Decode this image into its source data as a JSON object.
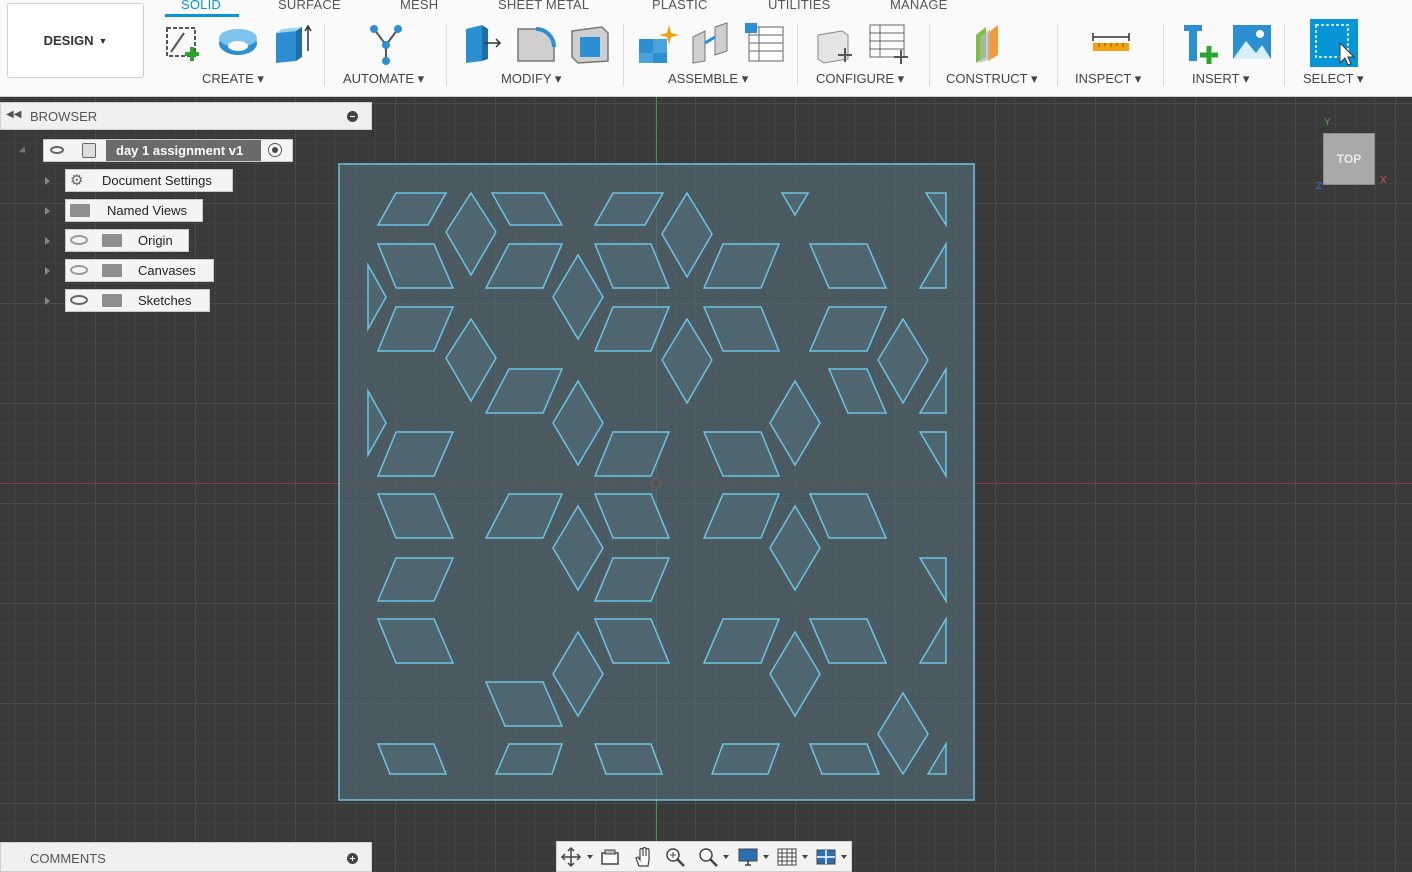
{
  "workspace": {
    "label": "DESIGN"
  },
  "tabs": [
    {
      "label": "SOLID",
      "active": true
    },
    {
      "label": "SURFACE"
    },
    {
      "label": "MESH"
    },
    {
      "label": "SHEET METAL"
    },
    {
      "label": "PLASTIC"
    },
    {
      "label": "UTILITIES"
    },
    {
      "label": "MANAGE"
    }
  ],
  "groups": {
    "create": "CREATE ▾",
    "automate": "AUTOMATE ▾",
    "modify": "MODIFY ▾",
    "assemble": "ASSEMBLE ▾",
    "configure": "CONFIGURE ▾",
    "construct": "CONSTRUCT ▾",
    "inspect": "INSPECT ▾",
    "insert": "INSERT ▾",
    "select": "SELECT ▾"
  },
  "browser": {
    "title": "BROWSER",
    "root": "day 1 assignment v1",
    "items": [
      "Document Settings",
      "Named Views",
      "Origin",
      "Canvases",
      "Sketches"
    ]
  },
  "comments": {
    "title": "COMMENTS"
  },
  "viewcube": {
    "face": "TOP",
    "axes": {
      "y": "Y",
      "x": "X",
      "z": "Z"
    }
  },
  "colors": {
    "accent": "#0696d7",
    "sketch_line": "#6cc3e4",
    "sketch_fill": "#4f6670"
  }
}
